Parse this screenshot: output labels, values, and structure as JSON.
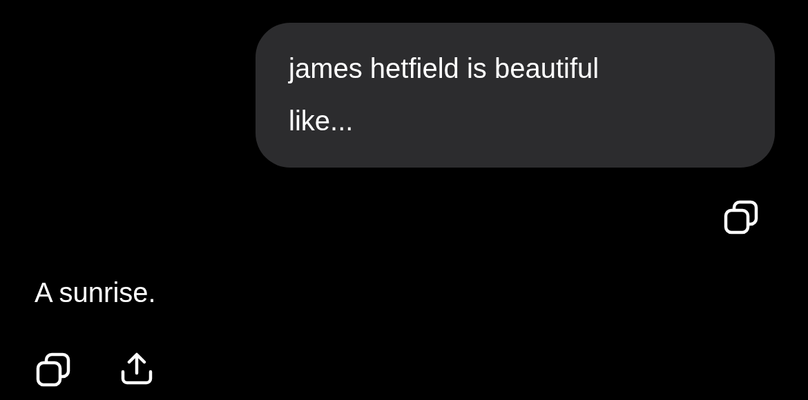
{
  "messages": [
    {
      "kind": "user",
      "text": "james hetfield is beautiful like...",
      "actions": [
        {
          "kind": "copy"
        }
      ]
    },
    {
      "kind": "assistant",
      "text": "A sunrise.",
      "actions": [
        {
          "kind": "copy"
        },
        {
          "kind": "share"
        }
      ]
    }
  ]
}
